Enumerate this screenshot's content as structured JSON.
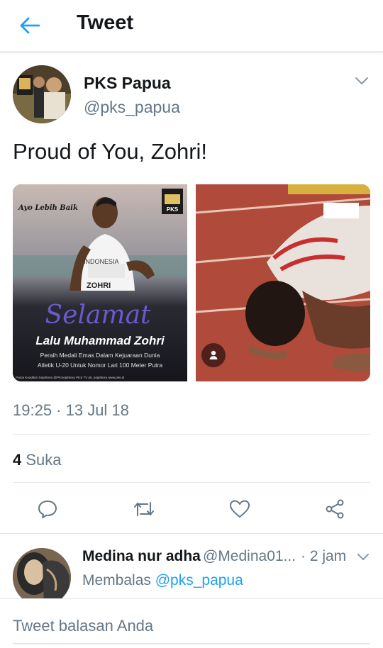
{
  "header": {
    "title": "Tweet",
    "back_icon": "arrow-left-icon"
  },
  "tweet": {
    "author_name": "PKS Papua",
    "author_handle": "@pks_papua",
    "text": "Proud of You, Zohri!",
    "timestamp": "19:25 · 13 Jul 18",
    "likes_count": "4",
    "likes_label": "Suka",
    "media_left": {
      "script": "Ayo Lebih Baik",
      "logo": "PKS",
      "jersey": "INDONESIA",
      "bib": "ZOHRI",
      "headline": "Selamat",
      "name": "Lalu Muhammad Zohri",
      "subtitle_1": "Peraih Medali Emas Dalam Kejuaraan Dunia",
      "subtitle_2": "Atletik U-20 Untuk Nomor Lari 100 Meter Putra",
      "footer": "Partai Keadilan Sejahtera   @PKSejahtera   PKS TV   pk_sejahtera   www.pks.id"
    },
    "media_right": {
      "icon": "person-icon"
    }
  },
  "actions": [
    "reply-icon",
    "retweet-icon",
    "like-icon",
    "share-icon"
  ],
  "reply": {
    "name": "Medina nur adha",
    "handle": "@Medina01...",
    "time": "· 2 jam",
    "replying_prefix": "Membalas",
    "replying_to": "@pks_papua"
  },
  "compose": {
    "placeholder": "Tweet balasan Anda"
  },
  "colors": {
    "accent": "#1da1f2",
    "text": "#14171a",
    "secondary": "#657786",
    "divider": "#e1e8ed"
  }
}
